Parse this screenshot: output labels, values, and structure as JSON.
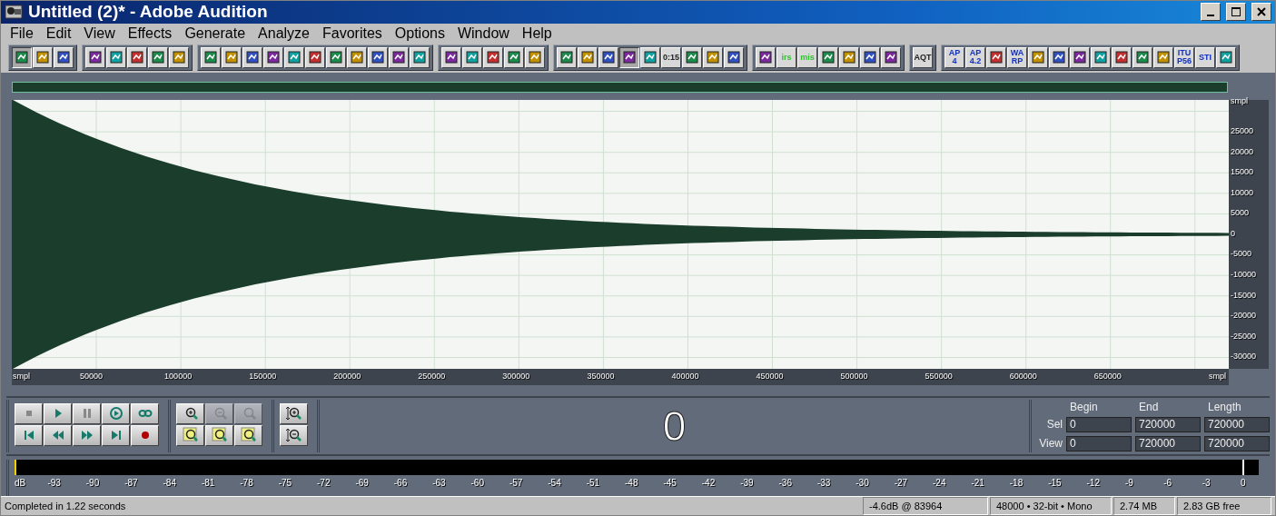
{
  "window": {
    "title": "Untitled (2)* - Adobe Audition"
  },
  "menu": [
    "File",
    "Edit",
    "View",
    "Effects",
    "Generate",
    "Analyze",
    "Favorites",
    "Options",
    "Window",
    "Help"
  ],
  "toolbar_groups": [
    {
      "buttons": [
        {
          "selected": true
        },
        {
          "selected": false
        },
        {
          "selected": false
        }
      ]
    },
    {
      "buttons": [
        {
          "selected": false
        },
        {
          "selected": false
        },
        {
          "selected": false
        },
        {
          "selected": false
        },
        {
          "selected": false
        }
      ]
    },
    {
      "buttons": [
        {
          "selected": false
        },
        {
          "selected": false
        },
        {
          "selected": false
        },
        {
          "selected": false
        },
        {
          "selected": false
        },
        {
          "selected": false
        },
        {
          "selected": false
        },
        {
          "selected": false
        },
        {
          "selected": false
        },
        {
          "selected": false
        },
        {
          "selected": false
        }
      ]
    },
    {
      "buttons": [
        {
          "selected": false
        },
        {
          "selected": false
        },
        {
          "selected": false
        },
        {
          "selected": false
        },
        {
          "selected": false
        }
      ]
    },
    {
      "buttons": [
        {
          "selected": false
        },
        {
          "selected": false
        },
        {
          "selected": false
        },
        {
          "selected": true
        },
        {
          "selected": false
        },
        {
          "selected": false,
          "label": [
            "0:15"
          ]
        },
        {
          "selected": false
        },
        {
          "selected": false
        },
        {
          "selected": false
        }
      ]
    },
    {
      "buttons": [
        {
          "selected": false
        },
        {
          "selected": false,
          "label": [
            "irs"
          ]
        },
        {
          "selected": false,
          "label": [
            "mis"
          ]
        },
        {
          "selected": false
        },
        {
          "selected": false
        },
        {
          "selected": false
        },
        {
          "selected": false
        }
      ]
    },
    {
      "buttons": [
        {
          "selected": false,
          "label": [
            "AQT"
          ]
        }
      ]
    },
    {
      "buttons": [
        {
          "selected": false,
          "label": [
            "AP",
            "4"
          ]
        },
        {
          "selected": false,
          "label": [
            "AP",
            "4.2"
          ]
        },
        {
          "selected": false
        },
        {
          "selected": false,
          "label": [
            "WA",
            "RP"
          ]
        },
        {
          "selected": false
        },
        {
          "selected": false
        },
        {
          "selected": false
        },
        {
          "selected": false
        },
        {
          "selected": false
        },
        {
          "selected": false
        },
        {
          "selected": false
        },
        {
          "selected": false,
          "label": [
            "ITU",
            "P56"
          ]
        },
        {
          "selected": false,
          "label": [
            "STI"
          ]
        },
        {
          "selected": false
        }
      ]
    }
  ],
  "waveform": {
    "x_axis": [
      "smpl",
      "50000",
      "100000",
      "150000",
      "200000",
      "250000",
      "300000",
      "350000",
      "400000",
      "450000",
      "500000",
      "550000",
      "600000",
      "650000",
      "smpl"
    ],
    "y_axis": [
      "smpl",
      "25000",
      "20000",
      "15000",
      "10000",
      "5000",
      "0",
      "-5000",
      "-10000",
      "-15000",
      "-20000",
      "-25000",
      "-30000"
    ]
  },
  "transport": [
    {
      "kind": "stop"
    },
    {
      "kind": "play"
    },
    {
      "kind": "pause"
    },
    {
      "kind": "play-to-end"
    },
    {
      "kind": "loop"
    },
    {
      "kind": "go-start"
    },
    {
      "kind": "rewind"
    },
    {
      "kind": "forward"
    },
    {
      "kind": "go-end"
    },
    {
      "kind": "record"
    }
  ],
  "zoom": [
    {
      "kind": "zoom-in",
      "disabled": false
    },
    {
      "kind": "zoom-out",
      "disabled": true
    },
    {
      "kind": "zoom-full",
      "disabled": true
    },
    {
      "kind": "zoom-left",
      "disabled": false
    },
    {
      "kind": "zoom-right",
      "disabled": false
    },
    {
      "kind": "zoom-sel",
      "disabled": false
    }
  ],
  "vzoom": [
    {
      "kind": "vzoom-in"
    },
    {
      "kind": "vzoom-out"
    }
  ],
  "time_display": "0",
  "selection": {
    "columns": [
      "Begin",
      "End",
      "Length"
    ],
    "rows": [
      {
        "label": "Sel",
        "values": [
          "0",
          "720000",
          "720000"
        ]
      },
      {
        "label": "View",
        "values": [
          "0",
          "720000",
          "720000"
        ]
      }
    ]
  },
  "meter": {
    "ticks": [
      "dB",
      "-93",
      "-90",
      "-87",
      "-84",
      "-81",
      "-78",
      "-75",
      "-72",
      "-69",
      "-66",
      "-63",
      "-60",
      "-57",
      "-54",
      "-51",
      "-48",
      "-45",
      "-42",
      "-39",
      "-36",
      "-33",
      "-30",
      "-27",
      "-24",
      "-21",
      "-18",
      "-15",
      "-12",
      "-9",
      "-6",
      "-3",
      "0"
    ]
  },
  "status_bar": {
    "message": "Completed in 1.22 seconds",
    "fields": [
      "-4.6dB @ 83964",
      "48000 • 32-bit • Mono",
      "2.74 MB",
      "2.83 GB free"
    ]
  }
}
